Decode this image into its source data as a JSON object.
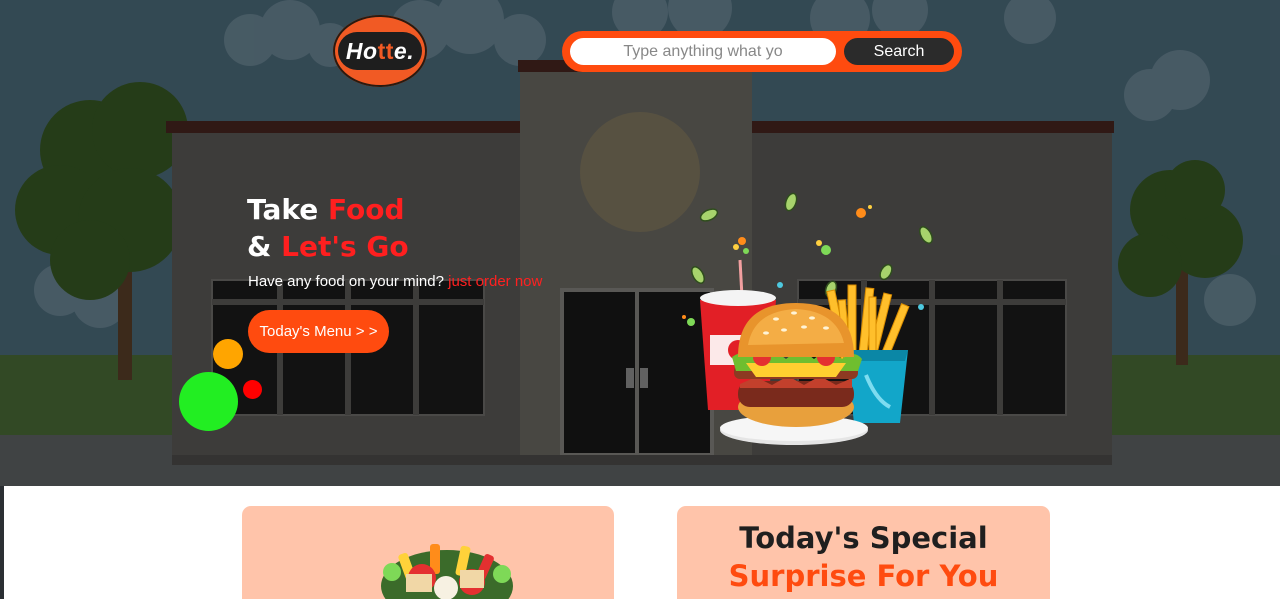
{
  "header": {
    "logo": {
      "text_main": "Ho",
      "text_accent": "tt",
      "text_end": "e."
    },
    "search": {
      "placeholder": "Type anything what yo",
      "button_label": "Search"
    }
  },
  "hero": {
    "headline_line1_white": "Take ",
    "headline_line1_red": "Food",
    "headline_line2_white": "& ",
    "headline_line2_red": "Let's Go",
    "tagline_white": "Have any food on your mind? ",
    "tagline_red": "just order now",
    "menu_button": "Today's Menu > >"
  },
  "cards": {
    "special_title": "Today's Special",
    "special_subtitle": "Surprise For You"
  },
  "colors": {
    "accent_orange": "#ff4b0f",
    "accent_red": "#ff1f1f",
    "card_bg": "#ffc4aa",
    "dot_green": "#22ee22",
    "dot_yellow": "#ffa500",
    "dot_red": "#ff0000"
  },
  "icons": {
    "logo": "hotte-logo-icon",
    "food": "burger-fries-drink-illustration",
    "salad": "salad-bowl-illustration"
  }
}
